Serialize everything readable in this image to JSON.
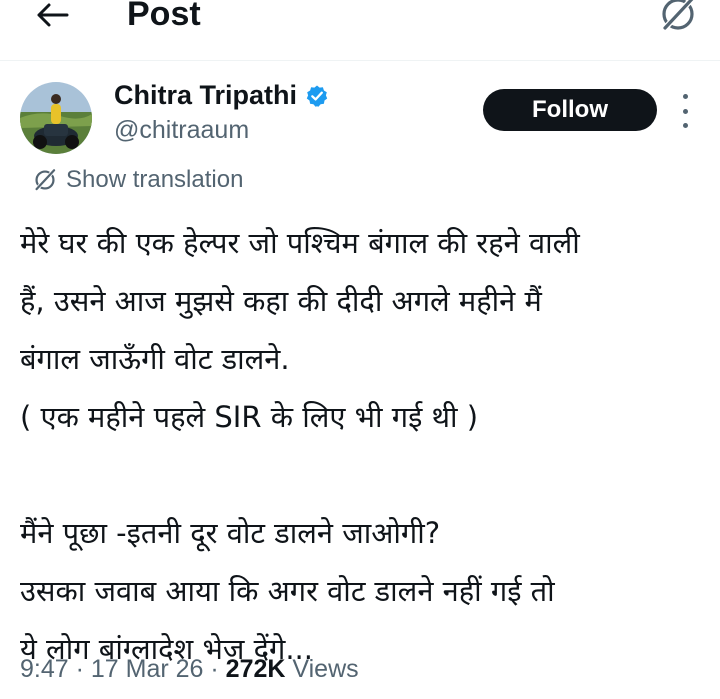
{
  "header": {
    "back_icon": "arrow-left-icon",
    "title": "Post",
    "grok_icon": "grok-icon"
  },
  "author": {
    "name": "Chitra Tripathi",
    "handle": "@chitraaum",
    "verified_color": "#1d9bf0",
    "follow_label": "Follow"
  },
  "translation": {
    "icon": "grok-icon",
    "label": "Show translation"
  },
  "tweet": {
    "lines": [
      "मेरे घर की एक हेल्पर जो पश्चिम बंगाल की रहने वाली",
      "हैं, उसने आज मुझसे कहा की दीदी अगले महीने मैं",
      "बंगाल जाऊँगी वोट डालने.",
      "( एक महीने पहले SIR के लिए भी गई थी )",
      "",
      "मैंने पूछा -इतनी दूर वोट डालने जाओगी?",
      "उसका जवाब आया कि अगर वोट डालने नहीं गई तो",
      "ये लोग बांग्लादेश भेज देंगे..."
    ]
  },
  "meta": {
    "time": "9:47",
    "separator": " · ",
    "date": "17 Mar 26",
    "views_count": "272K",
    "views_label": "Views"
  },
  "colors": {
    "text_primary": "#0f1419",
    "text_secondary": "#536471",
    "accent": "#1d9bf0",
    "button_bg": "#0f1419"
  }
}
